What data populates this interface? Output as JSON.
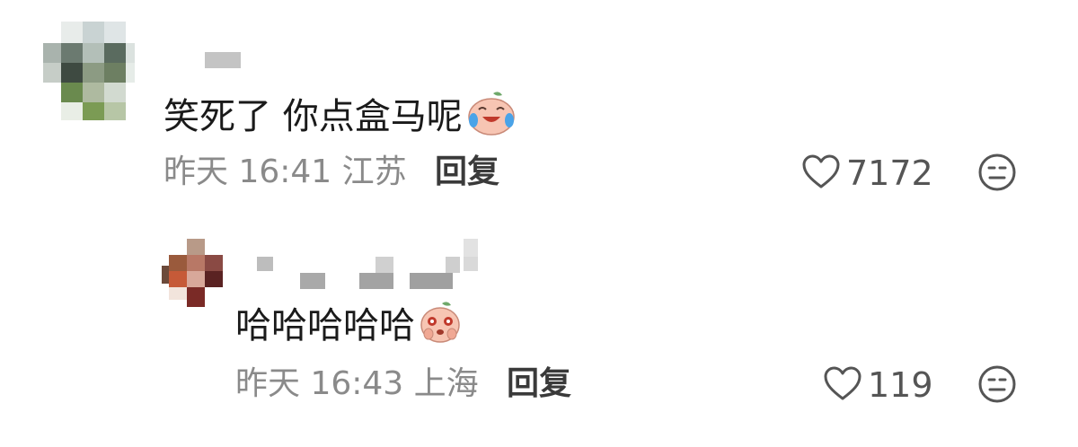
{
  "comments": [
    {
      "text": "笑死了 你点盒马呢",
      "emoji": "laughing-crying-peach-emoji",
      "time": "昨天 16:41",
      "location": "江苏",
      "reply_label": "回复",
      "likes": "7172",
      "replies": [
        {
          "text": "哈哈哈哈哈",
          "emoji": "starry-eyed-peach-emoji",
          "time": "昨天 16:43",
          "location": "上海",
          "reply_label": "回复",
          "likes": "119"
        }
      ]
    }
  ],
  "colors": {
    "meta_text": "#8a8a8a",
    "content_text": "#1a1a1a",
    "icon_stroke": "#555555"
  }
}
